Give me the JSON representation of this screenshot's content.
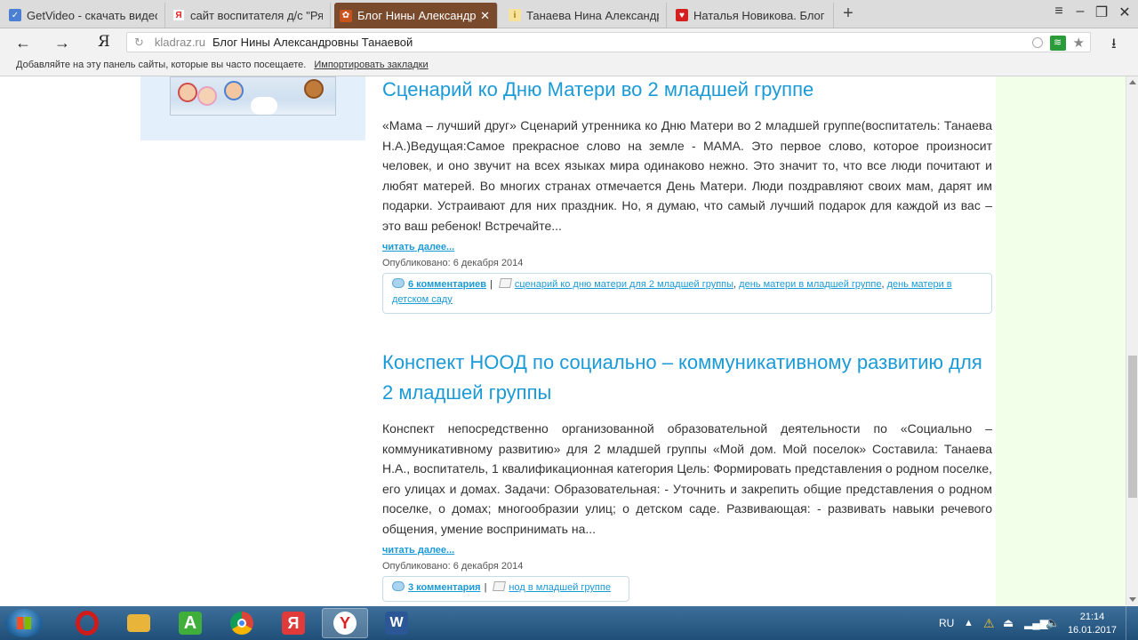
{
  "browser": {
    "tabs": [
      {
        "title": "GetVideo - скачать видео с",
        "favicon": "getvideo-favicon",
        "color": "#4a7fd4"
      },
      {
        "title": "сайт воспитателя д/с \"Рябин",
        "favicon": "yandex-favicon",
        "color": "#e02020"
      },
      {
        "title": "Блог Нины Александровн",
        "favicon": "blog-favicon",
        "color": "#c8541d",
        "active": true
      },
      {
        "title": "Танаева Нина Александрови",
        "favicon": "doc-favicon",
        "color": "#e8c73a"
      },
      {
        "title": "Наталья Новикова. Блог - С",
        "favicon": "heart-favicon",
        "color": "#d42020"
      }
    ],
    "address": {
      "domain": "kladraz.ru",
      "page_title": "Блог Нины Александровны Танаевой"
    },
    "bookmarks": {
      "hint": "Добавляйте на эту панель сайты, которые вы часто посещаете.",
      "import_label": "Импортировать закладки"
    }
  },
  "posts": [
    {
      "title": "Сценарий ко Дню Матери во 2 младшей группе",
      "body": "«Мама – лучший друг» Сценарий утренника ко Дню Матери во 2 младшей группе(воспитатель: Танаева Н.А.)Ведущая:Самое прекрасное слово на земле - МАМА. Это первое слово, которое произносит человек, и оно звучит на всех языках мира одинаково нежно. Это значит то, что все люди почитают и любят матерей. Во многих странах отмечается День Матери. Люди поздравляют своих мам, дарят им подарки. Устраивают для них праздник. Но, я думаю, что самый лучший подарок для каждой из вас – это ваш ребенок! Встречайте...",
      "read_more": "читать далее...",
      "published": "Опубликовано: 6 декабря 2014",
      "comments": "6 комментариев",
      "tags": [
        "сценарий ко дню матери для 2 младшей группы",
        "день матери в младшей группе",
        "день матери в детском саду"
      ]
    },
    {
      "title": "Конспект НООД по социально – коммуникативному развитию для 2 младшей группы",
      "body": "Конспект непосредственно организованной образовательной деятельности по «Социально – коммуникативному развитию» для 2 младшей группы «Мой дом. Мой поселок» Составила: Танаева Н.А., воспитатель, 1 квалификационная категория Цель: Формировать представления о родном поселке, его улицах и домах. Задачи: Образовательная: - Уточнить и закрепить общие представления о родном поселке, о домах; многообразии улиц; о детском саде. Развивающая: - развивать навыки речевого общения, умение воспринимать на...",
      "read_more": "читать далее...",
      "published": "Опубликовано: 6 декабря 2014",
      "comments": "3 комментария",
      "tags": [
        "нод в младшей группе"
      ]
    }
  ],
  "taskbar": {
    "apps": [
      {
        "name": "opera-icon",
        "glyph": "O",
        "color": "#d01b1b"
      },
      {
        "name": "file-explorer-icon",
        "glyph": "",
        "color": "#e8b53a"
      },
      {
        "name": "android-app-icon",
        "glyph": "A",
        "color": "#3fae3a"
      },
      {
        "name": "chrome-icon",
        "glyph": "",
        "color": "#dd4b39"
      },
      {
        "name": "yandex-search-icon",
        "glyph": "Я",
        "color": "#e03a3a"
      },
      {
        "name": "yandex-browser-icon",
        "glyph": "Y",
        "color": "#e02020",
        "active": true
      },
      {
        "name": "word-icon",
        "glyph": "W",
        "color": "#2b5797"
      }
    ],
    "language": "RU",
    "time": "21:14",
    "date": "16.01.2017"
  }
}
